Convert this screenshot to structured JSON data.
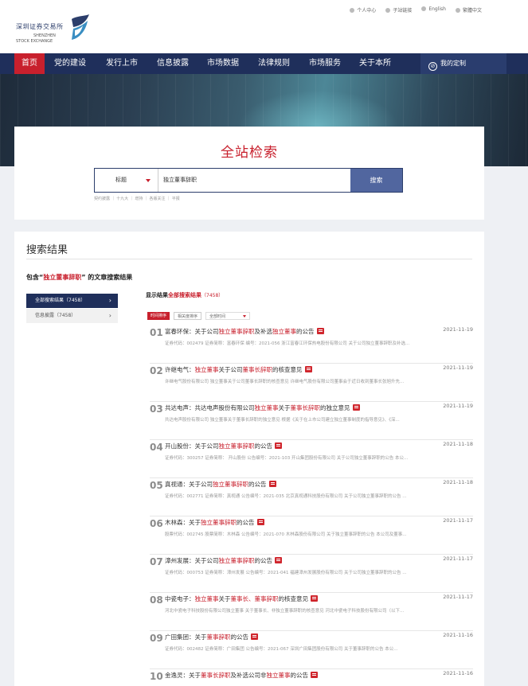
{
  "header": {
    "logo_cn": "深圳证券交易所",
    "logo_en1": "SHENZHEN",
    "logo_en2": "STOCK EXCHANGE",
    "links": [
      "个人中心",
      "子站链接",
      "English",
      "繁體中文"
    ]
  },
  "nav": {
    "items": [
      "首页",
      "党的建设",
      "发行上市",
      "信息披露",
      "市场数据",
      "法律规则",
      "市场服务",
      "关于本所"
    ],
    "custom": "我的定制",
    "active_color": "#c8202d",
    "bg_color": "#1f2f5b"
  },
  "search": {
    "title": "全站检索",
    "select_value": "标题",
    "input_value": "独立董事辞职",
    "button": "搜索",
    "hot_words": "契约披露 ｜ 十九大 ｜ 增持 ｜ 各版关注 ｜ 平报"
  },
  "results": {
    "heading": "搜索结果",
    "sub_prefix": "包含“",
    "sub_keyword": "独立董事辞职",
    "sub_suffix": "” 的文章搜索结果",
    "categories": [
      {
        "label": "全部搜索结果（7458）",
        "arrow": "›"
      },
      {
        "label": "信息披露（7458）",
        "arrow": "›"
      }
    ],
    "shown_prefix": "显示结果",
    "shown_keyword": "全部搜索结果",
    "shown_count": "（7458）",
    "sort": [
      "时间排序",
      "相关度排序",
      "全部时间"
    ],
    "items": [
      {
        "no": "01",
        "pre": "富春环保：关于公司",
        "kw1": "独立董事辞职",
        "mid": "及补选",
        "kw2": "独立董事",
        "post": "的公告",
        "date": "2021-11-19",
        "desc": "证券代码：002479 证券简称：富春环保 编号：2021-056 浙江富春江环保热电股份有限公司 关于公司独立董事辞职及补选..."
      },
      {
        "no": "02",
        "pre": "许继电气：",
        "kw1": "独立董事",
        "mid": "关于公司",
        "kw2": "董事长辞职",
        "post": "的核查意见",
        "date": "2021-11-19",
        "desc": "许继电气股份有限公司 独立董事关于公司董事长辞职的核查意见 许继电气股份有限公司董事会于近日收到董事长张旭升先..."
      },
      {
        "no": "03",
        "pre": "共达电声：共达电声股份有限公司",
        "kw1": "独立董事",
        "mid": "关于",
        "kw2": "董事长辞职",
        "post": "的独立意见",
        "date": "2021-11-19",
        "desc": "共达电声股份有限公司 独立董事关于董事长辞职的独立意见 根据《关于在上市公司建立独立董事制度的指导意见》、《深..."
      },
      {
        "no": "04",
        "pre": "开山股份：关于公司",
        "kw1": "独立董事辞职",
        "mid": "",
        "kw2": "",
        "post": "的公告",
        "date": "2021-11-18",
        "desc": "证券代码：300257 证券简称： 开山股份 公告编号：2021-103 开山集团股份有限公司 关于公司独立董事辞职的公告 本公..."
      },
      {
        "no": "05",
        "pre": "真视通：关于公司",
        "kw1": "独立董事辞职",
        "mid": "",
        "kw2": "",
        "post": "的公告",
        "date": "2021-11-18",
        "desc": "证券代码：002771 证券简称：真视通 公告编号：2021-035 北京真视通科技股份有限公司 关于公司独立董事辞职的公告 ..."
      },
      {
        "no": "06",
        "pre": "木林森：关于",
        "kw1": "独立董事辞职",
        "mid": "",
        "kw2": "",
        "post": "的公告",
        "date": "2021-11-17",
        "desc": "股票代码：002745 股票简称：木林森 公告编号：2021-070 木林森股份有限公司 关于独立董事辞职的公告 本公司及董事..."
      },
      {
        "no": "07",
        "pre": "漳州发展：关于公司",
        "kw1": "独立董事辞职",
        "mid": "",
        "kw2": "",
        "post": "的公告",
        "date": "2021-11-17",
        "desc": "证券代码：000753 证券简称：漳州发展 公告编号：2021-041 福建漳州发展股份有限公司 关于公司独立董事辞职的公告 ..."
      },
      {
        "no": "08",
        "pre": "中瓷电子：",
        "kw1": "独立董事",
        "mid": "关于",
        "kw2": "董事长、董事辞职",
        "post": "的核查意见",
        "date": "2021-11-17",
        "desc": "河北中瓷电子科技股份有限公司独立董事 关于董事长、非独立董事辞职的核查意见 河北中瓷电子科技股份有限公司（以下..."
      },
      {
        "no": "09",
        "pre": "广田集团：关于",
        "kw1": "董事辞职",
        "mid": "",
        "kw2": "",
        "post": "的公告",
        "date": "2021-11-16",
        "desc": "证券代码：002482 证券简称：广田集团 公告编号：2021-067 深圳广田集团股份有限公司 关于董事辞职的公告 本公..."
      },
      {
        "no": "10",
        "pre": "金逸灵：关于",
        "kw1": "董事长辞职",
        "mid": "及补选公司非",
        "kw2": "独立董事",
        "post": "的公告",
        "date": "2021-11-16",
        "desc": ""
      }
    ]
  }
}
